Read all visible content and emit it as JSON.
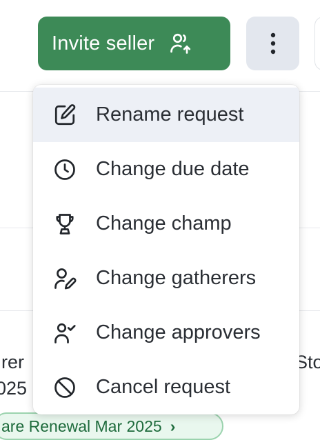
{
  "toolbar": {
    "invite_label": "Invite seller",
    "invite_icon": "user-arrow-up-icon",
    "more_icon": "more-vertical-icon",
    "accent_color": "#3d8a57"
  },
  "menu": {
    "items": [
      {
        "label": "Rename request",
        "icon": "edit-icon"
      },
      {
        "label": "Change due date",
        "icon": "clock-icon"
      },
      {
        "label": "Change champ",
        "icon": "trophy-icon"
      },
      {
        "label": "Change gatherers",
        "icon": "user-pen-icon"
      },
      {
        "label": "Change approvers",
        "icon": "user-check-icon"
      },
      {
        "label": "Cancel request",
        "icon": "ban-icon"
      }
    ]
  },
  "background": {
    "fragment_left_top": "rer",
    "fragment_left_bottom": "025",
    "fragment_right": "Sto",
    "pill_label": "are Renewal Mar 2025",
    "pill_chevron": "›"
  }
}
